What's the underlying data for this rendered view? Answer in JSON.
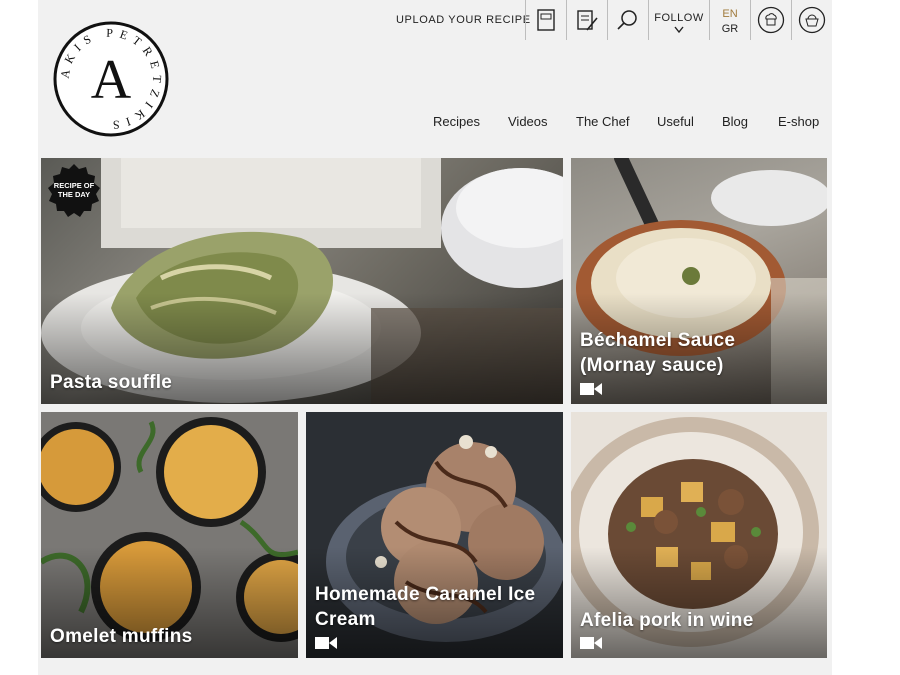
{
  "logo": {
    "letter": "A",
    "ring_text": "AKIS PETRETZIKIS"
  },
  "header": {
    "upload_label": "UPLOAD YOUR RECIPE",
    "follow_label": "FOLLOW",
    "lang_active": "EN",
    "lang_other": "GR",
    "icons": [
      "book-icon",
      "notepad-pencil-icon",
      "search-icon",
      "chef-hat-icon",
      "basket-icon"
    ]
  },
  "nav": {
    "items": [
      "Recipes",
      "Videos",
      "The Chef",
      "Useful",
      "Blog",
      "E-shop"
    ]
  },
  "badge": {
    "line1": "RECIPE OF",
    "line2": "THE DAY"
  },
  "tiles": [
    {
      "title": "Pasta souffle",
      "video": false
    },
    {
      "title_line1": "Béchamel Sauce",
      "title_line2": "(Mornay sauce)",
      "video": true
    },
    {
      "title": "Omelet muffins",
      "video": false
    },
    {
      "title_line1": "Homemade Caramel Ice",
      "title_line2": "Cream",
      "video": true
    },
    {
      "title": "Afelia pork in wine",
      "video": true
    }
  ],
  "colors": {
    "accent": "#a07a3c",
    "text": "#222222",
    "panel": "#f1f1f1"
  }
}
